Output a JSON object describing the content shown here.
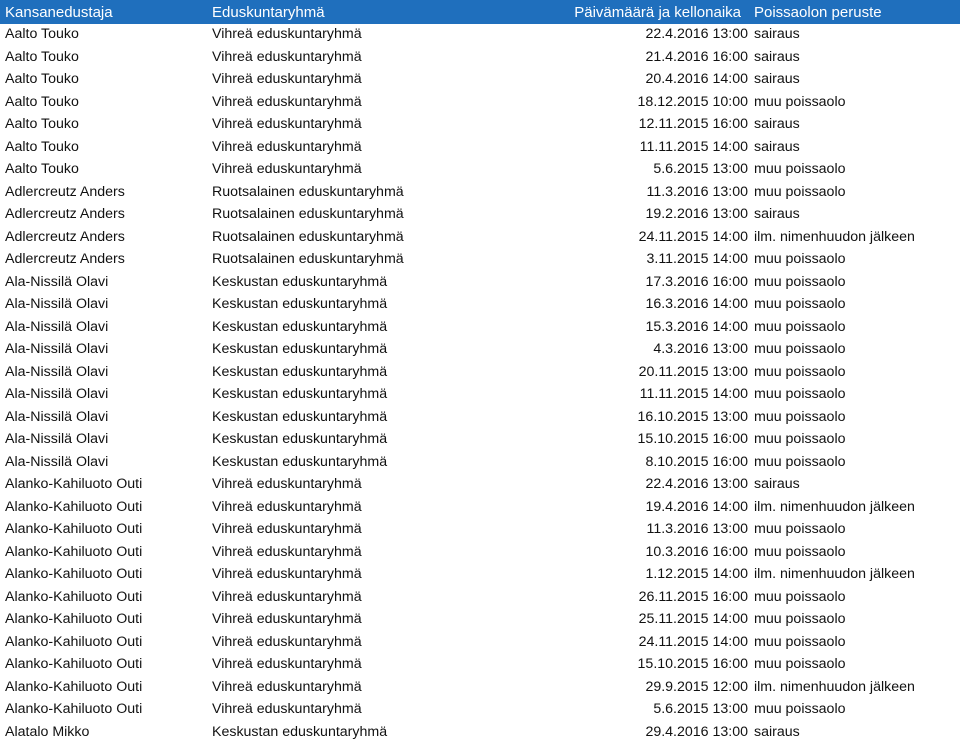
{
  "headers": {
    "representative": "Kansanedustaja",
    "group": "Eduskuntaryhmä",
    "datetime": "Päivämäärä ja kellonaika",
    "reason": "Poissaolon peruste"
  },
  "rows": [
    [
      "Aalto Touko",
      "Vihreä eduskuntaryhmä",
      "22.4.2016 13:00",
      "sairaus"
    ],
    [
      "Aalto Touko",
      "Vihreä eduskuntaryhmä",
      "21.4.2016 16:00",
      "sairaus"
    ],
    [
      "Aalto Touko",
      "Vihreä eduskuntaryhmä",
      "20.4.2016 14:00",
      "sairaus"
    ],
    [
      "Aalto Touko",
      "Vihreä eduskuntaryhmä",
      "18.12.2015 10:00",
      "muu poissaolo"
    ],
    [
      "Aalto Touko",
      "Vihreä eduskuntaryhmä",
      "12.11.2015 16:00",
      "sairaus"
    ],
    [
      "Aalto Touko",
      "Vihreä eduskuntaryhmä",
      "11.11.2015 14:00",
      "sairaus"
    ],
    [
      "Aalto Touko",
      "Vihreä eduskuntaryhmä",
      "5.6.2015 13:00",
      "muu poissaolo"
    ],
    [
      "Adlercreutz Anders",
      "Ruotsalainen eduskuntaryhmä",
      "11.3.2016 13:00",
      "muu poissaolo"
    ],
    [
      "Adlercreutz Anders",
      "Ruotsalainen eduskuntaryhmä",
      "19.2.2016 13:00",
      "sairaus"
    ],
    [
      "Adlercreutz Anders",
      "Ruotsalainen eduskuntaryhmä",
      "24.11.2015 14:00",
      "ilm. nimenhuudon jälkeen"
    ],
    [
      "Adlercreutz Anders",
      "Ruotsalainen eduskuntaryhmä",
      "3.11.2015 14:00",
      "muu poissaolo"
    ],
    [
      "Ala-Nissilä Olavi",
      "Keskustan eduskuntaryhmä",
      "17.3.2016 16:00",
      "muu poissaolo"
    ],
    [
      "Ala-Nissilä Olavi",
      "Keskustan eduskuntaryhmä",
      "16.3.2016 14:00",
      "muu poissaolo"
    ],
    [
      "Ala-Nissilä Olavi",
      "Keskustan eduskuntaryhmä",
      "15.3.2016 14:00",
      "muu poissaolo"
    ],
    [
      "Ala-Nissilä Olavi",
      "Keskustan eduskuntaryhmä",
      "4.3.2016 13:00",
      "muu poissaolo"
    ],
    [
      "Ala-Nissilä Olavi",
      "Keskustan eduskuntaryhmä",
      "20.11.2015 13:00",
      "muu poissaolo"
    ],
    [
      "Ala-Nissilä Olavi",
      "Keskustan eduskuntaryhmä",
      "11.11.2015 14:00",
      "muu poissaolo"
    ],
    [
      "Ala-Nissilä Olavi",
      "Keskustan eduskuntaryhmä",
      "16.10.2015 13:00",
      "muu poissaolo"
    ],
    [
      "Ala-Nissilä Olavi",
      "Keskustan eduskuntaryhmä",
      "15.10.2015 16:00",
      "muu poissaolo"
    ],
    [
      "Ala-Nissilä Olavi",
      "Keskustan eduskuntaryhmä",
      "8.10.2015 16:00",
      "muu poissaolo"
    ],
    [
      "Alanko-Kahiluoto Outi",
      "Vihreä eduskuntaryhmä",
      "22.4.2016 13:00",
      "sairaus"
    ],
    [
      "Alanko-Kahiluoto Outi",
      "Vihreä eduskuntaryhmä",
      "19.4.2016 14:00",
      "ilm. nimenhuudon jälkeen"
    ],
    [
      "Alanko-Kahiluoto Outi",
      "Vihreä eduskuntaryhmä",
      "11.3.2016 13:00",
      "muu poissaolo"
    ],
    [
      "Alanko-Kahiluoto Outi",
      "Vihreä eduskuntaryhmä",
      "10.3.2016 16:00",
      "muu poissaolo"
    ],
    [
      "Alanko-Kahiluoto Outi",
      "Vihreä eduskuntaryhmä",
      "1.12.2015 14:00",
      "ilm. nimenhuudon jälkeen"
    ],
    [
      "Alanko-Kahiluoto Outi",
      "Vihreä eduskuntaryhmä",
      "26.11.2015 16:00",
      "muu poissaolo"
    ],
    [
      "Alanko-Kahiluoto Outi",
      "Vihreä eduskuntaryhmä",
      "25.11.2015 14:00",
      "muu poissaolo"
    ],
    [
      "Alanko-Kahiluoto Outi",
      "Vihreä eduskuntaryhmä",
      "24.11.2015 14:00",
      "muu poissaolo"
    ],
    [
      "Alanko-Kahiluoto Outi",
      "Vihreä eduskuntaryhmä",
      "15.10.2015 16:00",
      "muu poissaolo"
    ],
    [
      "Alanko-Kahiluoto Outi",
      "Vihreä eduskuntaryhmä",
      "29.9.2015 12:00",
      "ilm. nimenhuudon jälkeen"
    ],
    [
      "Alanko-Kahiluoto Outi",
      "Vihreä eduskuntaryhmä",
      "5.6.2015 13:00",
      "muu poissaolo"
    ],
    [
      "Alatalo Mikko",
      "Keskustan eduskuntaryhmä",
      "29.4.2016 13:00",
      "sairaus"
    ]
  ],
  "colors": {
    "header_bg": "#1f6fbd",
    "header_text": "#ffffff"
  }
}
